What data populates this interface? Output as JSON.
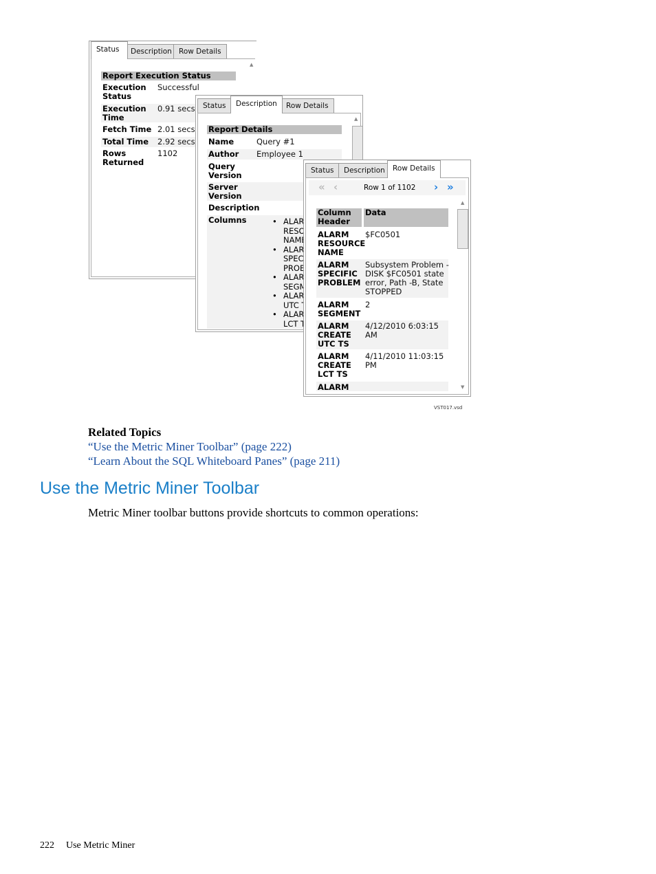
{
  "tabs": [
    "Status",
    "Description",
    "Row Details"
  ],
  "status_panel": {
    "header": "Report Execution Status",
    "rows": [
      {
        "label": [
          "Execution",
          "Status"
        ],
        "value": "Successful"
      },
      {
        "label": [
          "Execution",
          "Time"
        ],
        "value": "0.91 secs"
      },
      {
        "label": [
          "Fetch Time"
        ],
        "value": "2.01 secs"
      },
      {
        "label": [
          "Total Time"
        ],
        "value": "2.92 secs"
      },
      {
        "label": [
          "Rows",
          "Returned"
        ],
        "value": "1102"
      }
    ]
  },
  "description_panel": {
    "header": "Report Details",
    "rows": [
      {
        "label": [
          "Name"
        ],
        "value": "Query #1"
      },
      {
        "label": [
          "Author"
        ],
        "value": "Employee 1"
      },
      {
        "label": [
          "Query",
          "Version"
        ],
        "value": ""
      },
      {
        "label": [
          "Server",
          "Version"
        ],
        "value": ""
      },
      {
        "label": [
          "Description"
        ],
        "value": ""
      },
      {
        "label": [
          "Columns"
        ],
        "value": ""
      }
    ],
    "columns": [
      [
        "ALARI",
        "RESO",
        "NAME"
      ],
      [
        "ALARI",
        "SPECI",
        "PROB"
      ],
      [
        "ALARI",
        "SEGM"
      ],
      [
        "ALARI",
        "UTC T"
      ],
      [
        "ALARI",
        "LCT T"
      ]
    ]
  },
  "row_details_panel": {
    "nav_text": "Row 1 of 1102",
    "col_header": [
      "Column",
      "Header"
    ],
    "data_header": "Data",
    "rows": [
      {
        "label": [
          "ALARM",
          "RESOURCE",
          "NAME"
        ],
        "value": [
          "$FC0501"
        ]
      },
      {
        "label": [
          "ALARM",
          "SPECIFIC",
          "PROBLEM"
        ],
        "value": [
          "Subsystem Problem -",
          "DISK $FC0501 state",
          "error, Path -B, State",
          "STOPPED"
        ]
      },
      {
        "label": [
          "ALARM",
          "SEGMENT"
        ],
        "value": [
          "2"
        ]
      },
      {
        "label": [
          "ALARM",
          "CREATE",
          "UTC TS"
        ],
        "value": [
          "4/12/2010 6:03:15",
          "AM"
        ]
      },
      {
        "label": [
          "ALARM",
          "CREATE",
          "LCT TS"
        ],
        "value": [
          "4/11/2010 11:03:15",
          "PM"
        ]
      },
      {
        "label": [
          "ALARM"
        ],
        "value": []
      }
    ]
  },
  "figure_id": "VST017.vsd",
  "related": {
    "title": "Related Topics",
    "links": [
      "“Use the Metric Miner Toolbar” (page 222)",
      "“Learn About the SQL Whiteboard Panes” (page 211)"
    ]
  },
  "section_title": "Use the Metric Miner Toolbar",
  "section_text": "Metric Miner toolbar buttons provide shortcuts to common operations:",
  "footer": {
    "page": "222",
    "title": "Use Metric Miner"
  },
  "colors": {
    "heading": "#1a7fc8",
    "header_bg": "#c0c0c0",
    "nav_arrow": "#1e7fe0"
  }
}
